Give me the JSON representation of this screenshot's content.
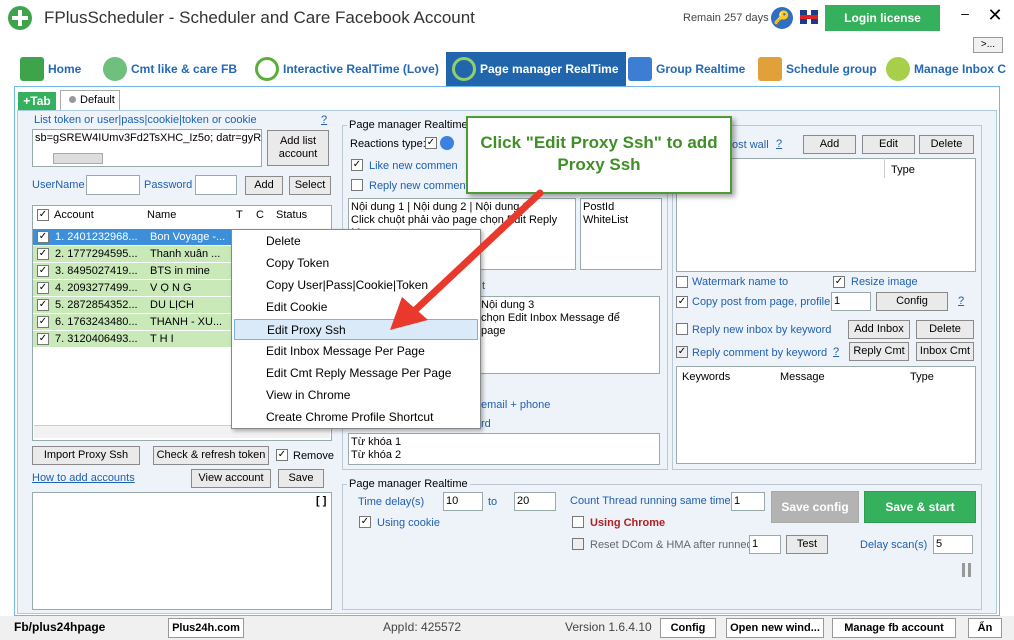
{
  "titlebar": {
    "title": "FPlusScheduler - Scheduler and Care Facebook Account",
    "remain": "Remain 257 days",
    "login_label": "Login license",
    "min": "–",
    "close": "✕",
    "more": ">..."
  },
  "tabs": [
    {
      "label": "Home"
    },
    {
      "label": "Cmt like & care FB"
    },
    {
      "label": "Interactive RealTime (Love)"
    },
    {
      "label": "Page manager RealTime"
    },
    {
      "label": "Group Realtime"
    },
    {
      "label": "Schedule group"
    },
    {
      "label": "Manage Inbox C"
    }
  ],
  "subtabs": {
    "add": "+Tab",
    "default": "Default"
  },
  "left": {
    "token_label": "List token or user|pass|cookie|token or cookie",
    "help": "?",
    "token_value": "sb=gSREW4IUmv3Fd2TsXHC_Iz5o; datr=gyRE",
    "add_list_btn": "Add list account",
    "username_label": "UserName",
    "password_label": "Password",
    "add_btn": "Add",
    "select_btn": "Select",
    "cols": {
      "account": "Account",
      "name": "Name",
      "t": "T",
      "c": "C",
      "status": "Status"
    },
    "rows": [
      {
        "account": "1. 2401232968...",
        "name": "Bon Voyage -..."
      },
      {
        "account": "2. 1777294595...",
        "name": "Thanh xuân ..."
      },
      {
        "account": "3. 8495027419...",
        "name": "BTS in mine"
      },
      {
        "account": "4. 2093277499...",
        "name": "V Ọ N G"
      },
      {
        "account": "5. 2872854352...",
        "name": "DU LỊCH"
      },
      {
        "account": "6. 1763243480...",
        "name": "THANH - XU..."
      },
      {
        "account": "7. 3120406493...",
        "name": "T H I"
      }
    ],
    "import_btn": "Import Proxy Ssh",
    "check_btn": "Check & refresh token",
    "remove_label": "Remove",
    "how_to": "How to add accounts",
    "view_btn": "View account",
    "save_btn": "Save",
    "bracket": "[ ]"
  },
  "mid": {
    "group_title": "Page manager Realtime",
    "reactions_label": "Reactions type:",
    "like_new_comment": "Like new commen",
    "reply_new_comment": "Reply new comment",
    "reply_text": [
      "Nội dung 1 | Nội dung 2 | Nội dung 3",
      "Click chuột phải vào page chọn Edit Reply Me",
      "page"
    ],
    "postid_list": [
      "PostId",
      "WhiteList"
    ],
    "t_label": "t",
    "inbox_text": [
      "Nội dung 3",
      "chọn Edit Inbox Message để",
      "page"
    ],
    "email_phone": "email + phone",
    "rd": "rd",
    "keywords": [
      "Từ khóa 1",
      "Từ khóa 2"
    ]
  },
  "right": {
    "post_wall": "ost wall",
    "help": "?",
    "add_btn": "Add",
    "edit_btn": "Edit",
    "delete_btn": "Delete",
    "type_col": "Type",
    "watermark": "Watermark name to",
    "resize": "Resize image",
    "copy_post": "Copy post from page, profile,",
    "copy_num": "1",
    "config_btn": "Config",
    "reply_inbox_kw": "Reply new inbox by keyword",
    "add_inbox_btn": "Add Inbox",
    "delete2_btn": "Delete",
    "reply_cmt_kw": "Reply comment by keyword",
    "reply_cmt_btn": "Reply Cmt",
    "inbox_cmt_btn": "Inbox Cmt",
    "cols": {
      "keywords": "Keywords",
      "message": "Message",
      "type": "Type"
    }
  },
  "bottom": {
    "group_title": "Page manager Realtime",
    "time_delay": "Time delay(s)",
    "delay_from": "10",
    "to": "to",
    "delay_to": "20",
    "count_thread": "Count Thread running same time",
    "thread_val": "1",
    "save_config": "Save config",
    "save_start": "Save & start",
    "using_cookie": "Using cookie",
    "using_chrome": "Using  Chrome",
    "reset_dcom": "Reset DCom & HMA after runned",
    "reset_val": "1",
    "test_btn": "Test",
    "delay_scan": "Delay scan(s)",
    "delay_scan_val": "5"
  },
  "context_menu": [
    "Delete",
    "Copy Token",
    "Copy User|Pass|Cookie|Token",
    "Edit Cookie",
    "Edit Proxy Ssh",
    "Edit Inbox Message Per Page",
    "Edit Cmt Reply Message Per Page",
    "View in Chrome",
    "Create Chrome Profile Shortcut"
  ],
  "tooltip": "Click \"Edit Proxy Ssh\" to add Proxy Ssh",
  "status": {
    "fb": "Fb/plus24hpage",
    "site": "Plus24h.com",
    "appid": "AppId: 425572",
    "version": "Version 1.6.4.10",
    "config": "Config",
    "open_new": "Open new wind...",
    "manage_fb": "Manage fb account",
    "lang": "Ẩn"
  }
}
